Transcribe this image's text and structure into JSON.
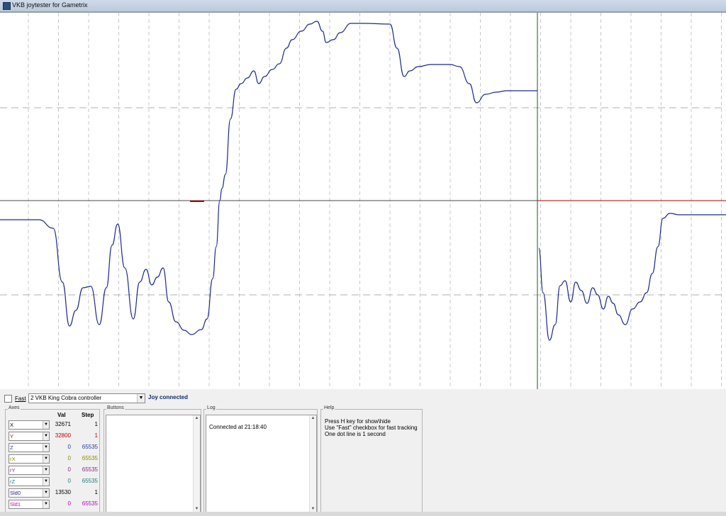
{
  "window": {
    "title": "VKB joytester for Gametrix"
  },
  "controls": {
    "fast_label": "Fast",
    "fast_checked": false,
    "device": "2 VKB King Cobra controller",
    "status": "Joy connected"
  },
  "axes": {
    "legend": "Axes",
    "col_val": "Val",
    "col_step": "Step",
    "rows": [
      {
        "name": "X",
        "val": "32671",
        "step": "1",
        "color": "#000000",
        "valcolor": "#000000"
      },
      {
        "name": "Y",
        "val": "32800",
        "step": "1",
        "color": "#c00000",
        "valcolor": "#c00000"
      },
      {
        "name": "Z",
        "val": "0",
        "step": "65535",
        "color": "#1f3f9f",
        "valcolor": "#1f3f9f"
      },
      {
        "name": "rX",
        "val": "0",
        "step": "65535",
        "color": "#8c8c00",
        "valcolor": "#8c8c00"
      },
      {
        "name": "rY",
        "val": "0",
        "step": "65535",
        "color": "#8b2a8b",
        "valcolor": "#8b2a8b"
      },
      {
        "name": "rZ",
        "val": "0",
        "step": "65535",
        "color": "#1f7f7f",
        "valcolor": "#1f7f7f"
      },
      {
        "name": "Sld0",
        "val": "13530",
        "step": "1",
        "color": "#1f1f8f",
        "valcolor": "#000000"
      },
      {
        "name": "Sld1",
        "val": "0",
        "step": "65535",
        "color": "#c000c0",
        "valcolor": "#c000c0"
      }
    ]
  },
  "buttons": {
    "legend": "Buttons"
  },
  "log": {
    "legend": "Log",
    "lines": [
      "Connected at 21:18:40"
    ]
  },
  "help": {
    "legend": "Help",
    "lines": [
      "Press H key for show\\hide",
      "Use \"Fast\" checkbox for fast tracking",
      "One dot line is 1 second"
    ]
  },
  "colors": {
    "trace": "#1c2a8c",
    "flat": "#000000",
    "red_flat": "#b00000",
    "cursor": "#1e5a1e"
  }
}
